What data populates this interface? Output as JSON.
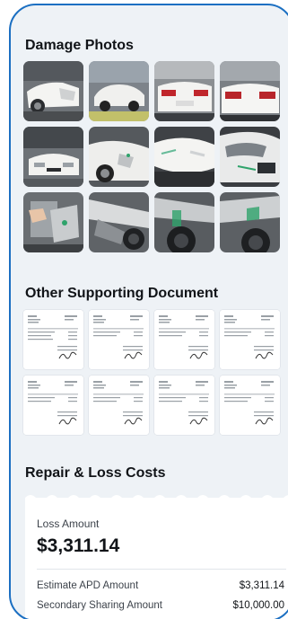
{
  "damage_photos": {
    "title": "Damage Photos",
    "photos": [
      {
        "icon": "car-front-damage-photo"
      },
      {
        "icon": "car-side-photo"
      },
      {
        "icon": "car-rear-photo"
      },
      {
        "icon": "car-rear-photo"
      },
      {
        "icon": "car-front-photo"
      },
      {
        "icon": "car-front-damage-photo"
      },
      {
        "icon": "bumper-closeup-photo"
      },
      {
        "icon": "headlight-closeup-photo"
      },
      {
        "icon": "engine-bay-photo"
      },
      {
        "icon": "frame-damage-photo"
      },
      {
        "icon": "wheel-frame-photo"
      },
      {
        "icon": "wheel-frame-photo"
      }
    ]
  },
  "supporting_documents": {
    "title": "Other Supporting Document",
    "documents": [
      {
        "icon": "invoice-document"
      },
      {
        "icon": "invoice-document"
      },
      {
        "icon": "invoice-document"
      },
      {
        "icon": "invoice-document"
      },
      {
        "icon": "invoice-document"
      },
      {
        "icon": "invoice-document"
      },
      {
        "icon": "invoice-document"
      },
      {
        "icon": "invoice-document"
      }
    ]
  },
  "repair_costs": {
    "title": "Repair & Loss Costs",
    "loss_amount_label": "Loss Amount",
    "loss_amount_value": "$3,311.14",
    "rows": [
      {
        "label": "Estimate APD Amount",
        "value": "$3,311.14"
      },
      {
        "label": "Secondary Sharing Amount",
        "value": "$10,000.00"
      }
    ]
  },
  "colors": {
    "frame_border": "#1b6fc2",
    "background": "#eef2f6",
    "card": "#ffffff"
  }
}
